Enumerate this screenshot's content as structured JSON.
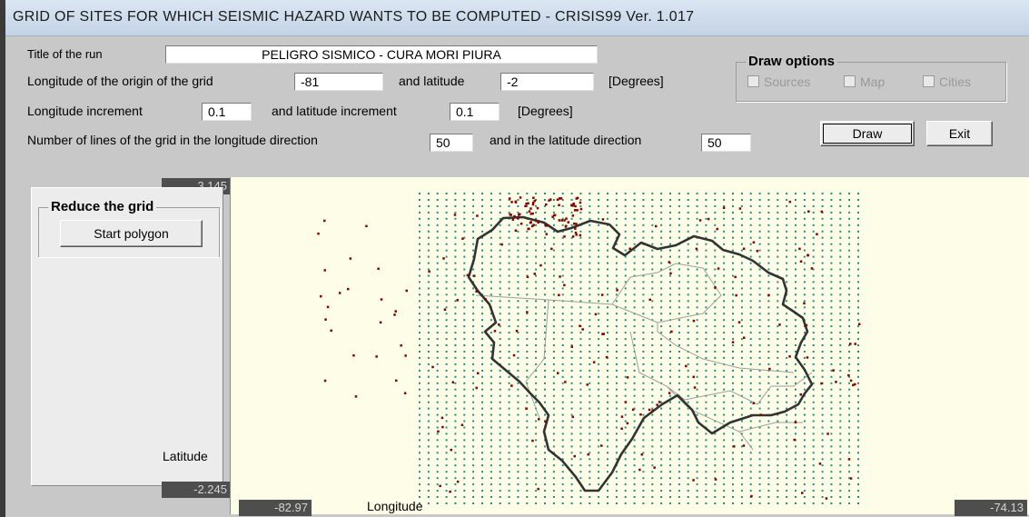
{
  "window": {
    "title": "GRID OF SITES FOR WHICH SEISMIC HAZARD WANTS TO BE COMPUTED - CRISIS99 Ver. 1.017"
  },
  "form": {
    "run_title_label": "Title of the run",
    "run_title_value": "PELIGRO SISMICO - CURA MORI PIURA",
    "origin_lon_label": "Longitude of the origin of the grid",
    "origin_lon_value": "-81",
    "origin_lat_label": "and latitude",
    "origin_lat_value": "-2",
    "degrees_1": "[Degrees]",
    "lon_inc_label": "Longitude increment",
    "lon_inc_value": "0.1",
    "lat_inc_label": "and latitude increment",
    "lat_inc_value": "0.1",
    "degrees_2": "[Degrees]",
    "n_lon_label": "Number of lines of the grid in the longitude direction",
    "n_lon_value": "50",
    "n_lat_label": "and in the latitude direction",
    "n_lat_value": "50"
  },
  "draw_options": {
    "legend": "Draw options",
    "sources": "Sources",
    "map": "Map",
    "cities": "Cities"
  },
  "buttons": {
    "draw": "Draw",
    "exit": "Exit",
    "start_polygon": "Start polygon"
  },
  "reduce_grid": {
    "legend": "Reduce the grid"
  },
  "readouts": {
    "lat_max": "3.145",
    "lat_min": "-2.245",
    "lon_min": "-82.97",
    "lon_max": "-74.13",
    "latitude_label": "Latitude",
    "longitude_label": "Longitude"
  },
  "colors": {
    "grid_points": "#1f8f86",
    "epicenters": "#8b0000",
    "boundary": "#333333",
    "plot_bg": "#fdfde8"
  }
}
